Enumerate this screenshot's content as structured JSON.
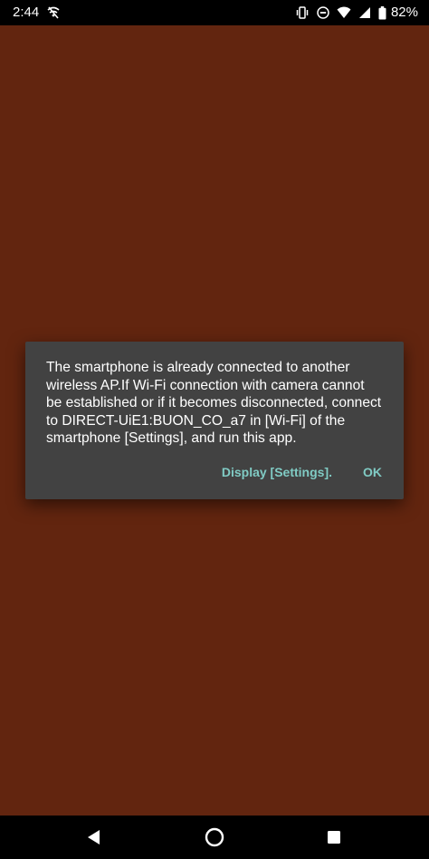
{
  "status_bar": {
    "time": "2:44",
    "battery_percent": "82%",
    "icons": [
      "wifi-off-notification-icon",
      "vibrate-icon",
      "do-not-disturb-icon",
      "wifi-icon",
      "signal-icon",
      "battery-icon"
    ]
  },
  "dialog": {
    "message": "The smartphone is already connected to another wireless AP.If Wi-Fi connection with camera cannot be established or if it becomes disconnected, connect to DIRECT-UiE1:BUON_CO_a7 in [Wi-Fi] of the smartphone [Settings], and run this app.",
    "settings_button_label": "Display [Settings].",
    "ok_button_label": "OK"
  },
  "nav_bar": {
    "icons": [
      "back-icon",
      "home-icon",
      "recents-icon"
    ]
  },
  "colors": {
    "background": "#62250f",
    "dialog_background": "#424242",
    "accent": "#80cbc4"
  }
}
